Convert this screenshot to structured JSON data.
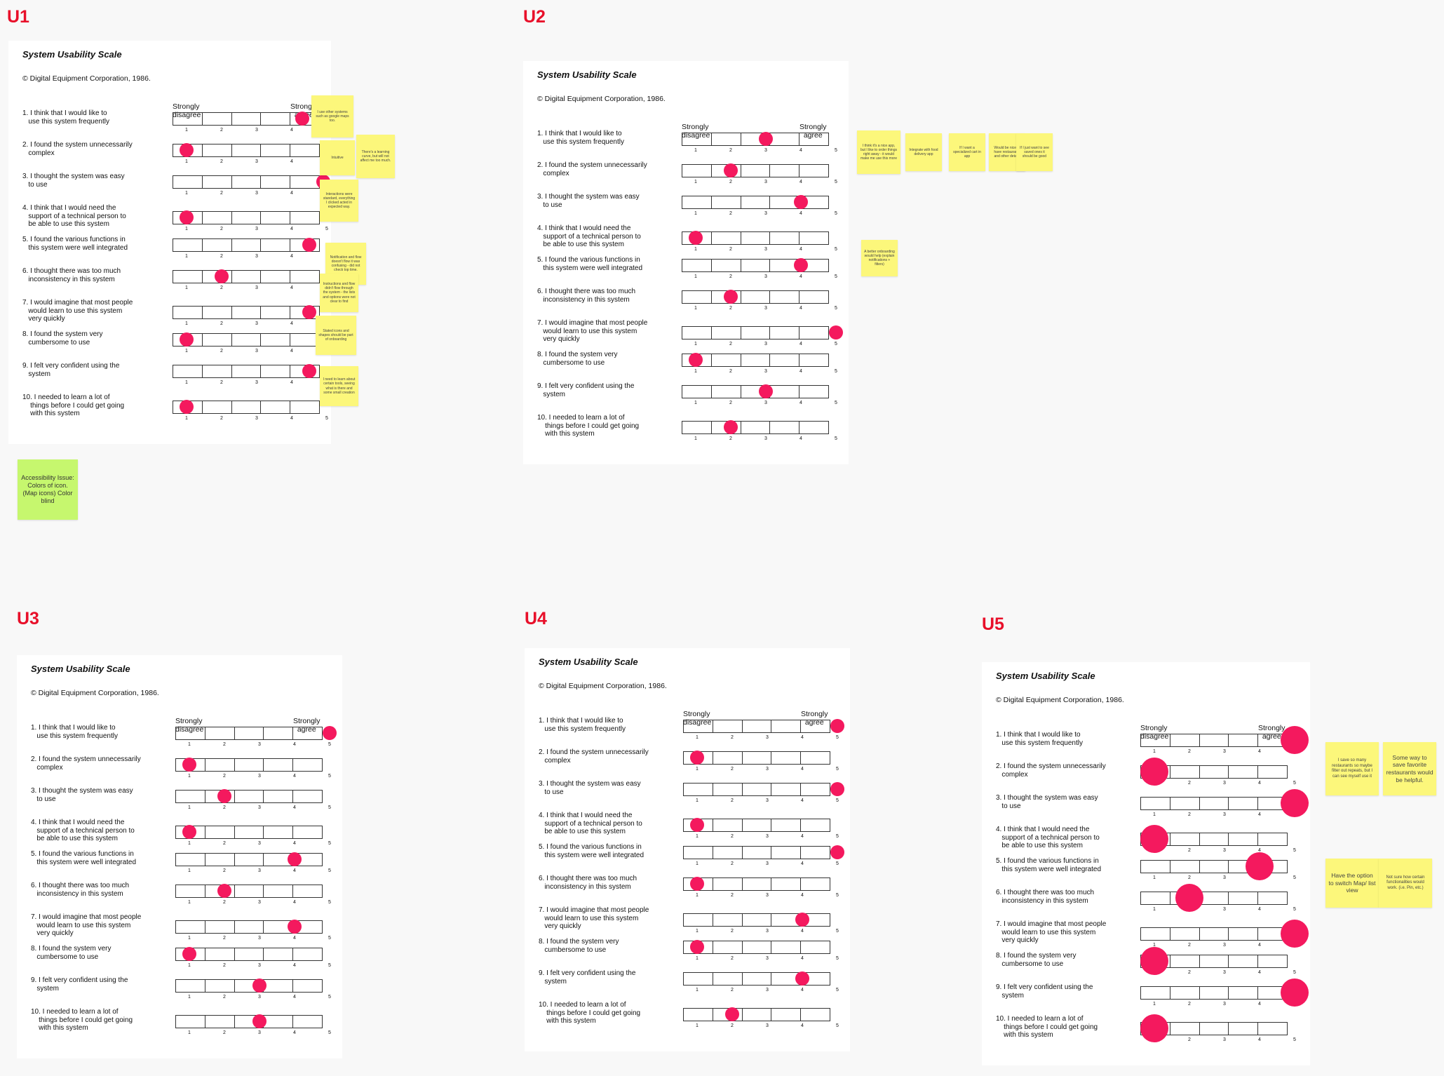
{
  "form": {
    "title": "System Usability Scale",
    "copyright": "© Digital Equipment Corporation, 1986.",
    "anchor_left": "Strongly\ndisagree",
    "anchor_right": "Strongly\nagree",
    "scale_numbers": [
      "1",
      "2",
      "3",
      "4",
      "5"
    ],
    "questions": [
      "1. I think that I would like to\n   use this system frequently",
      "2. I found the system unnecessarily\n   complex",
      "3. I thought the system was easy\n   to use",
      "4. I think that I would need the\n   support of a technical person to\n   be able to use this system",
      "5. I found the various functions in\n   this system were well integrated",
      "6. I thought there was too much\n   inconsistency in this system",
      "7. I would imagine that most people\n   would learn to use this system\n   very quickly",
      "8. I found the system very\n   cumbersome to use",
      "9. I felt very confident using the\n   system",
      "10. I needed to learn a lot of\n    things before I could get going\n    with this system"
    ]
  },
  "accent_color": "#f4195e",
  "label_color": "#e8102a",
  "sticky_yellow": "#fcf77b",
  "sticky_green": "#c6f76e",
  "boards": [
    {
      "id": "U1",
      "label": "U1",
      "answers": [
        4.3,
        1,
        4.9,
        1,
        4.5,
        2,
        4.5,
        1,
        4.5,
        1
      ],
      "notes": [
        {
          "text": "I use other systems such as google maps too.",
          "color": "yellow"
        },
        {
          "text": "Intuitive",
          "color": "yellow"
        },
        {
          "text": "There's a learning curve, but will not affect me too much.",
          "color": "yellow"
        },
        {
          "text": "Interactions were standard, everything I clicked acted in expected way.",
          "color": "yellow"
        },
        {
          "text": "Notification and flow doesn't flow it was confusing - did not check top time.",
          "color": "yellow"
        },
        {
          "text": "Instructions and flow didn't flow through the system - the lists and options were not clear to find",
          "color": "yellow"
        },
        {
          "text": "Stated icons and shapes should be part of onboarding",
          "color": "yellow"
        },
        {
          "text": "I need to learn about certain tools, seeing what is there and some small creation",
          "color": "yellow"
        },
        {
          "text": "Accessibility Issue: Colors of icon. (Map icons) Color blind",
          "color": "green"
        }
      ]
    },
    {
      "id": "U2",
      "label": "U2",
      "answers": [
        3,
        2,
        4,
        1,
        4,
        2,
        5,
        1,
        3,
        2
      ],
      "notes": [
        {
          "text": "I think it's a nice app, but I like to order things right away - it would make me use this more",
          "color": "yellow"
        },
        {
          "text": "Integrate with food delivery app",
          "color": "yellow"
        },
        {
          "text": "If I want a specialized cart in app",
          "color": "yellow"
        },
        {
          "text": "Would be nice to have restaurants and other details",
          "color": "yellow"
        },
        {
          "text": "If I just want to see saved ones it should be good",
          "color": "yellow"
        },
        {
          "text": "A better onboarding would help (explain notifications + filters)",
          "color": "yellow"
        }
      ]
    },
    {
      "id": "U3",
      "label": "U3",
      "answers": [
        5,
        1,
        2,
        1,
        4,
        2,
        4,
        1,
        3,
        3
      ],
      "notes": []
    },
    {
      "id": "U4",
      "label": "U4",
      "answers": [
        5,
        1,
        5,
        1,
        5,
        1,
        4,
        1,
        4,
        2
      ],
      "notes": []
    },
    {
      "id": "U5",
      "label": "U5",
      "answers": [
        5,
        1,
        5,
        1,
        4,
        2,
        5,
        1,
        5,
        1
      ],
      "notes": [
        {
          "text": "I save so many restaurants so maybe filter out repeats, but I can see myself use it",
          "color": "yellow"
        },
        {
          "text": "Some way to save favorite restaurants would be helpful.",
          "color": "yellow"
        },
        {
          "text": "Have the option to switch Map/ list view",
          "color": "yellow"
        },
        {
          "text": "Not sure how certain functionalities would work. (i.e. Pin, etc.)",
          "color": "yellow"
        }
      ]
    }
  ]
}
